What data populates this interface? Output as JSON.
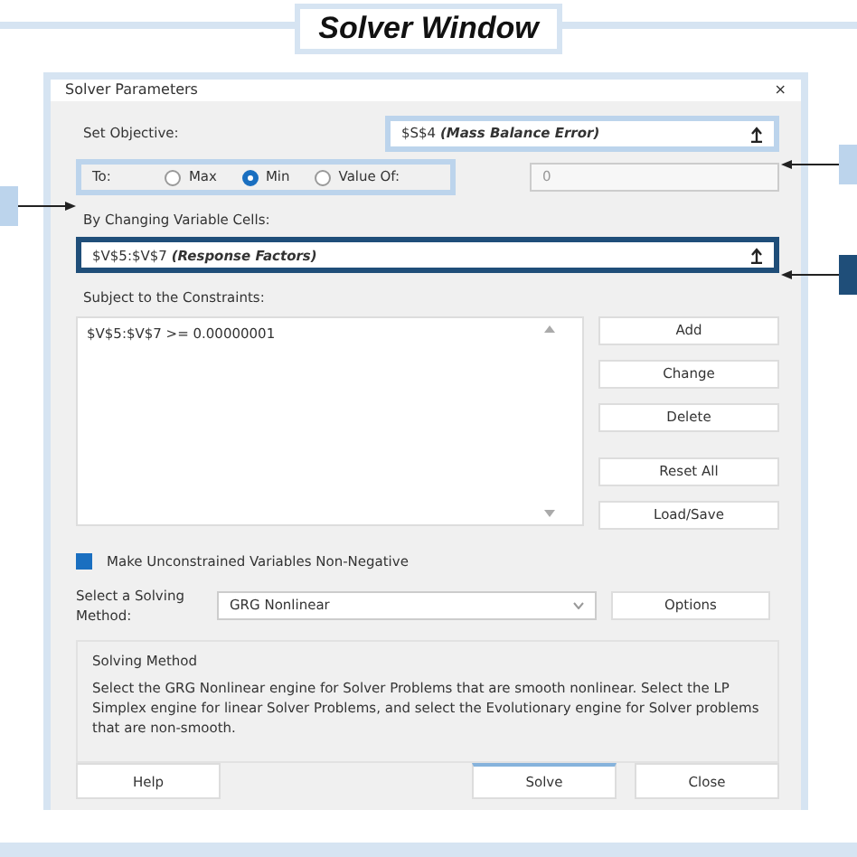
{
  "banner": {
    "title": "Solver Window"
  },
  "dialog": {
    "title": "Solver Parameters",
    "close": "×",
    "objective": {
      "label": "Set Objective:",
      "value": "$S$4 **(Mass Balance Error)**",
      "highlighted": true
    },
    "to": {
      "label": "To:",
      "options": [
        {
          "label": "Max",
          "selected": false
        },
        {
          "label": "Min",
          "selected": true
        },
        {
          "label": "Value Of:",
          "selected": false
        }
      ],
      "value": "0",
      "value_disabled": true,
      "highlighted": true
    },
    "changing": {
      "label": "By Changing Variable Cells:",
      "value": "$V$5:$V$7 **(Response Factors)**",
      "highlighted": true
    },
    "constraints": {
      "label": "Subject to the Constraints:",
      "items": [
        "$V$5:$V$7 >= 0.00000001"
      ]
    },
    "side_buttons": [
      "Add",
      "Change",
      "Delete",
      "Reset All",
      "Load/Save"
    ],
    "nonneg": {
      "label": "Make Unconstrained Variables Non-Negative",
      "checked": true
    },
    "method": {
      "label": "Select a Solving Method:",
      "value": "GRG Nonlinear",
      "button": "Options"
    },
    "description": {
      "title": "Solving Method",
      "text": "Select the GRG Nonlinear engine for Solver Problems that are smooth nonlinear. Select the LP Simplex engine for linear Solver Problems, and select the Evolutionary engine for Solver problems that are non-smooth."
    },
    "buttons": [
      "Help",
      "Solve",
      "Close"
    ]
  },
  "callouts": [
    {
      "color": "#bcd4ec"
    },
    {
      "color": "#bcd4ec"
    },
    {
      "color": "#1f4e79"
    }
  ]
}
